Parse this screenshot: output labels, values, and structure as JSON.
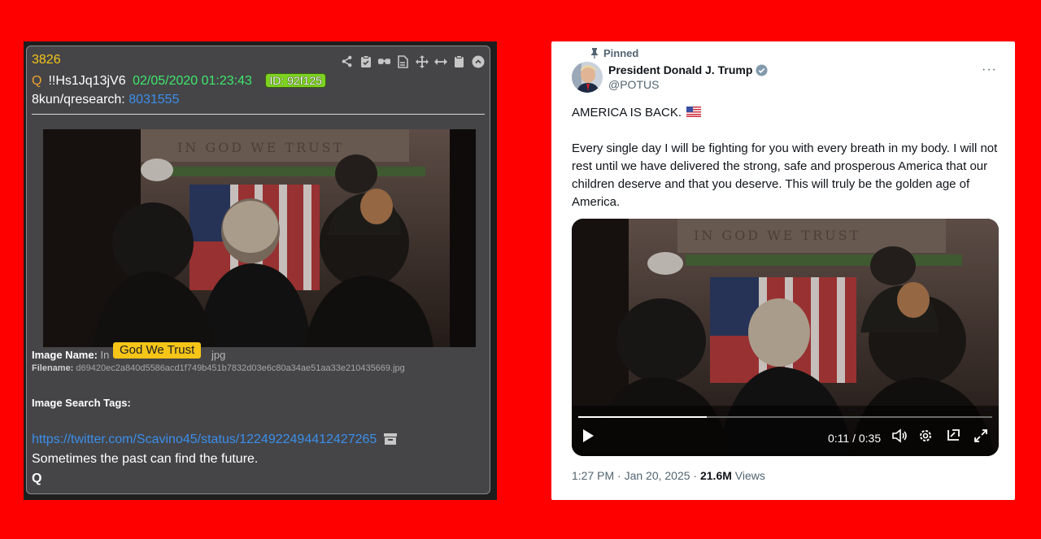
{
  "qpost": {
    "number": "3826",
    "q_label": "Q",
    "tripcode": "!!Hs1Jq13jV6",
    "datetime": "02/05/2020 01:23:43",
    "id_badge": "ID: 92f125",
    "board": "8kun/qresearch:",
    "post_number": "8031555",
    "toolbar_icons": [
      "share-icon",
      "clipboard-check-icon",
      "glasses-icon",
      "document-icon",
      "move-icon",
      "resize-icon",
      "clipboard-icon",
      "close-circle-icon"
    ],
    "image_name_label": "Image Name:",
    "image_name_prefix": "In",
    "image_name_highlight": "God We Trust",
    "image_name_suffix": "jpg",
    "filename_label": "Filename:",
    "filename": "d69420ec2a840d5586acd1f749b451b7832d03e6c80a34ae51aa33e210435669.jpg",
    "image_search_tags_label": "Image Search Tags:",
    "link": "https://twitter.com/Scavino45/status/1224922494412427265",
    "message": "Sometimes the past can find the future.",
    "signature": "Q"
  },
  "tweet": {
    "pinned_label": "Pinned",
    "author_name": "President Donald J. Trump",
    "handle": "@POTUS",
    "line1": "AMERICA IS BACK.",
    "body": "Every single day I will be fighting for you with every breath in my body. I will not rest until we have delivered the strong, safe and prosperous America that our children deserve and that you deserve. This will truly be the golden age of America.",
    "video": {
      "time": "0:11 / 0:35",
      "progress": 0.31
    },
    "timestamp": "1:27 PM · Jan 20, 2025 · ",
    "views_count": "21.6M",
    "views_label": " Views"
  },
  "colors": {
    "background": "#ff0000",
    "q_card": "#454548",
    "q_number": "#f5c518",
    "q_date": "#3de86a",
    "q_link": "#3b8eea",
    "q_id_badge": "#7ed321",
    "tweet_text": "#0f1419",
    "tweet_muted": "#536471"
  }
}
